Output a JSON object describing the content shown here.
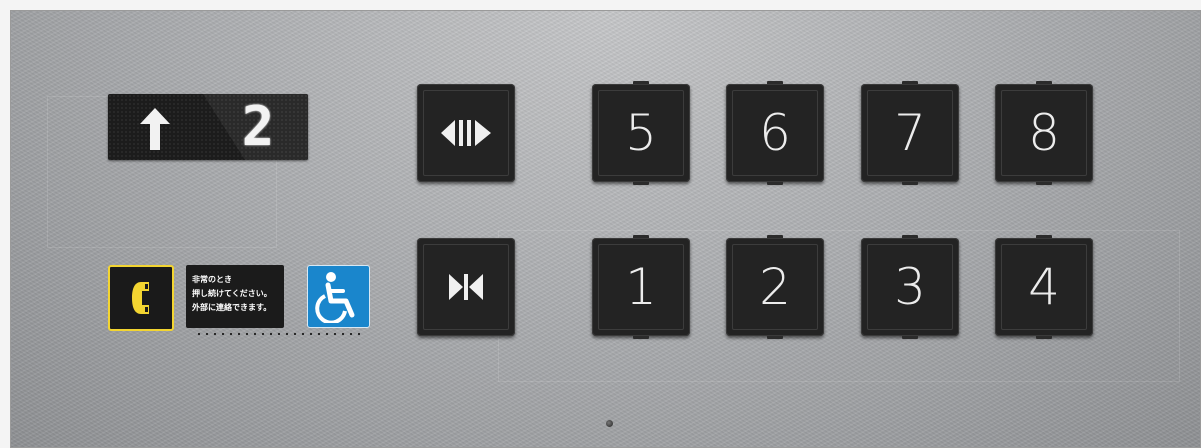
{
  "indicator": {
    "direction_icon": "up-arrow-icon",
    "current_floor": "2"
  },
  "door_controls": {
    "open_icon": "door-open-icon",
    "close_icon": "door-close-icon"
  },
  "floor_buttons": {
    "row_top": [
      "5",
      "6",
      "7",
      "8"
    ],
    "row_bottom": [
      "1",
      "2",
      "3",
      "4"
    ]
  },
  "emergency": {
    "phone_icon": "phone-icon",
    "notice_lines": [
      "非常のとき",
      "押し続けてください。",
      "外部に連絡できます。"
    ],
    "accessible_icon": "wheelchair-icon"
  },
  "colors": {
    "button_face": "#232323",
    "phone_border": "#f3d531",
    "accessible_bg": "#1a86cc"
  }
}
